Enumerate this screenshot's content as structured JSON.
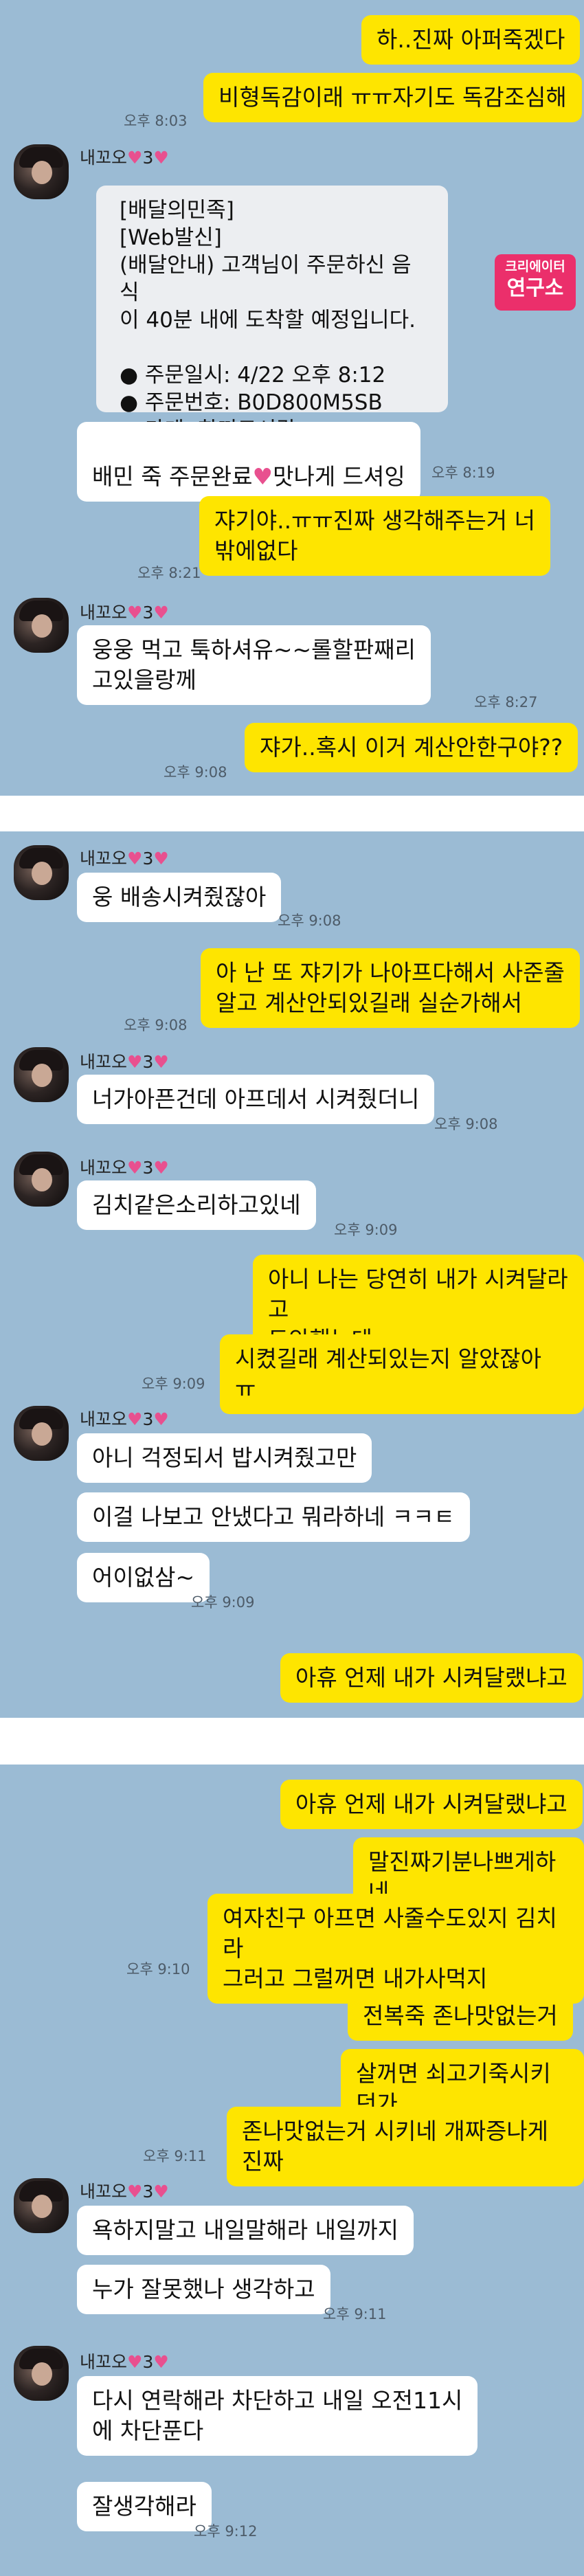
{
  "panel1": {
    "messages": [
      {
        "text": "하..진짜 아퍼죽겠다"
      },
      {
        "text": "비형독감이래 ㅠㅠ자기도 독감조심해",
        "time": "오후 8:03"
      },
      {
        "sender": "내꼬오",
        "badge": "3"
      },
      {
        "text": "배민 죽 주문완료",
        "after": "맛나게 드셔잉",
        "time": "오후 8:19"
      },
      {
        "text": "쟈기야..ㅠㅠ진짜 생각해주는거 너\n밖에없다",
        "time": "오후 8:21"
      },
      {
        "sender": "내꼬오",
        "badge": "3"
      },
      {
        "text": "웅웅 먹고 툭하셔유~~롤할판째리\n고있을랑께",
        "time": "오후 8:27"
      },
      {
        "text": "쟈가..혹시 이거 계산안한구야??",
        "time": "오후 9:08"
      }
    ],
    "notice": {
      "text": "[배달의민족]\n[Web발신]\n(배달안내) 고객님이 주문하신 음식\n이 40분 내에 도착할 예정입니다.\n\n● 주문일시: 4/22 오후 8:12\n● 주문번호: B0D800M5SB\n● 가게: 한끼도시락"
    },
    "watermark": {
      "line1": "크리에이터",
      "line2": "연구소"
    }
  },
  "panel2": {
    "messages": [
      {
        "sender": "내꼬오",
        "badge": "3"
      },
      {
        "text": "웅 배송시켜줬잖아",
        "time": "오후 9:08"
      },
      {
        "text": "아 난 또 쟈기가 나아프다해서 사준줄\n알고 계산안되있길래 실순가해서",
        "time": "오후 9:08"
      },
      {
        "sender": "내꼬오",
        "badge": "3"
      },
      {
        "text": "너가아픈건데 아프데서 시켜줬더니",
        "time": "오후 9:08"
      },
      {
        "sender": "내꼬오",
        "badge": "3"
      },
      {
        "text": "김치같은소리하고있네",
        "time": "오후 9:09"
      },
      {
        "text": "아니 나는 당연히 내가 시켜달라고\n도안했는데"
      },
      {
        "text": "시켰길래 계산되있는지 알았잖아 ㅠ",
        "time": "오후 9:09"
      },
      {
        "sender": "내꼬오",
        "badge": "3"
      },
      {
        "text": "아니 걱정되서 밥시켜줬고만"
      },
      {
        "text": "이걸 나보고 안냈다고 뭐라하네 ㅋㅋㅌ"
      },
      {
        "text": "어이없삼~",
        "time": "오후 9:09"
      },
      {
        "text": "아휴 언제 내가 시켜달랬냐고"
      }
    ]
  },
  "panel3": {
    "messages": [
      {
        "text": "아휴 언제 내가 시켜달랬냐고"
      },
      {
        "text": "말진짜기분나쁘게하네"
      },
      {
        "text": "여자친구 아프면 사줄수도있지 김치라\n그러고 그럴꺼면 내가사먹지",
        "time": "오후 9:10"
      },
      {
        "text": "전복죽 존나맛없는거"
      },
      {
        "text": "살꺼면 쇠고기죽시키던가"
      },
      {
        "text": "존나맛없는거 시키네 개짜증나게진짜",
        "time": "오후 9:11"
      },
      {
        "sender": "내꼬오",
        "badge": "3"
      },
      {
        "text": "욕하지말고 내일말해라 내일까지"
      },
      {
        "text": "누가 잘못했나 생각하고",
        "time": "오후 9:11"
      },
      {
        "sender": "내꼬오",
        "badge": "3"
      },
      {
        "text": "다시 연락해라 차단하고 내일 오전11시\n에 차단푼다"
      },
      {
        "text": "잘생각해라",
        "time": "오후 9:12"
      }
    ]
  },
  "heart_color": "#e8508f",
  "bubble_out_color": "#fee500",
  "bubble_in_color": "#ffffff",
  "background_color": "#9bbbd4"
}
